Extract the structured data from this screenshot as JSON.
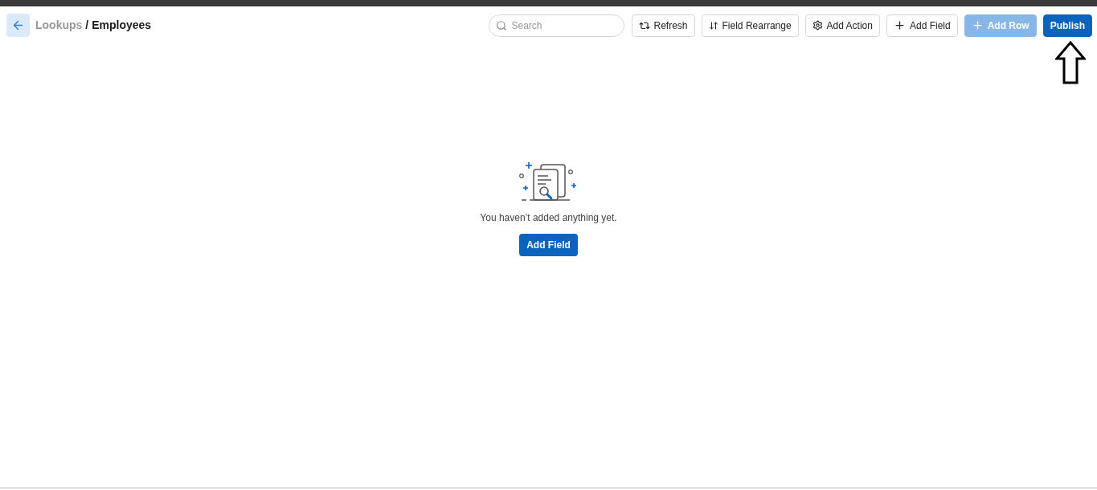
{
  "breadcrumb": {
    "parent": "Lookups",
    "separator": "/",
    "current": "Employees"
  },
  "search": {
    "placeholder": "Search"
  },
  "toolbar": [
    {
      "label": "Refresh",
      "kind": "outline",
      "disabled": false
    },
    {
      "label": "Field Rearrange",
      "kind": "outline",
      "disabled": false
    },
    {
      "label": "Add Action",
      "kind": "outline",
      "disabled": false
    },
    {
      "label": "Add Field",
      "kind": "outline",
      "disabled": false
    },
    {
      "label": "Add Row",
      "kind": "primary",
      "disabled": true
    },
    {
      "label": "Publish",
      "kind": "primary",
      "disabled": false
    }
  ],
  "empty_state": {
    "message": "You haven’t added anything yet.",
    "button": "Add Field"
  }
}
